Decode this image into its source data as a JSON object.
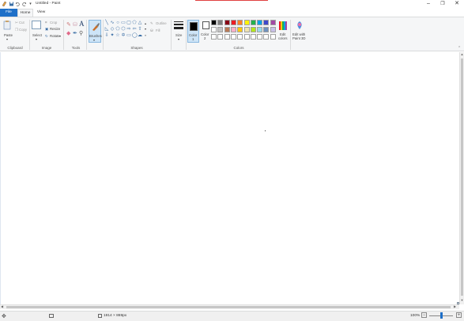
{
  "window": {
    "title": "Untitled - Paint",
    "minimize_glyph": "–",
    "maximize_glyph": "❐",
    "close_glyph": "✕"
  },
  "quick_access": {
    "qa_arrow_glyph": "▾"
  },
  "tabs": {
    "file": "File",
    "home": "Home",
    "view": "View"
  },
  "ribbon": {
    "clipboard": {
      "group": "Clipboard",
      "paste": "Paste",
      "cut": "Cut",
      "copy": "Copy"
    },
    "image": {
      "group": "Image",
      "select": "Select",
      "crop": "Crop",
      "resize": "Resize",
      "rotate": "Rotate"
    },
    "tools": {
      "group": "Tools"
    },
    "brushes": {
      "label": "Brushes"
    },
    "shapes": {
      "group": "Shapes",
      "outline": "Outline",
      "fill": "Fill"
    },
    "size": {
      "label": "Size"
    },
    "colors": {
      "group": "Colors",
      "color1_line1": "Color",
      "color1_line2": "1",
      "color2_line1": "Color",
      "color2_line2": "2",
      "edit_colors_line1": "Edit",
      "edit_colors_line2": "colors",
      "edit_3d_line1": "Edit with",
      "edit_3d_line2": "Paint 3D",
      "color1_value": "#000000",
      "color2_value": "#ffffff",
      "palette_row1": [
        "#000000",
        "#7f7f7f",
        "#880015",
        "#ed1c24",
        "#ff7f27",
        "#fff200",
        "#22b14c",
        "#00a2e8",
        "#3f48cc",
        "#a349a4"
      ],
      "palette_row2": [
        "#ffffff",
        "#c3c3c3",
        "#b97a57",
        "#ffaec9",
        "#ffc90e",
        "#efe4b0",
        "#b5e61d",
        "#99d9ea",
        "#7092be",
        "#c8bfe7"
      ],
      "palette_row3": [
        "#ffffff",
        "#ffffff",
        "#ffffff",
        "#ffffff",
        "#ffffff",
        "#ffffff",
        "#ffffff",
        "#ffffff",
        "#ffffff",
        "#ffffff"
      ]
    }
  },
  "status": {
    "dimensions": "1914 × 869px",
    "zoom": "100%"
  }
}
